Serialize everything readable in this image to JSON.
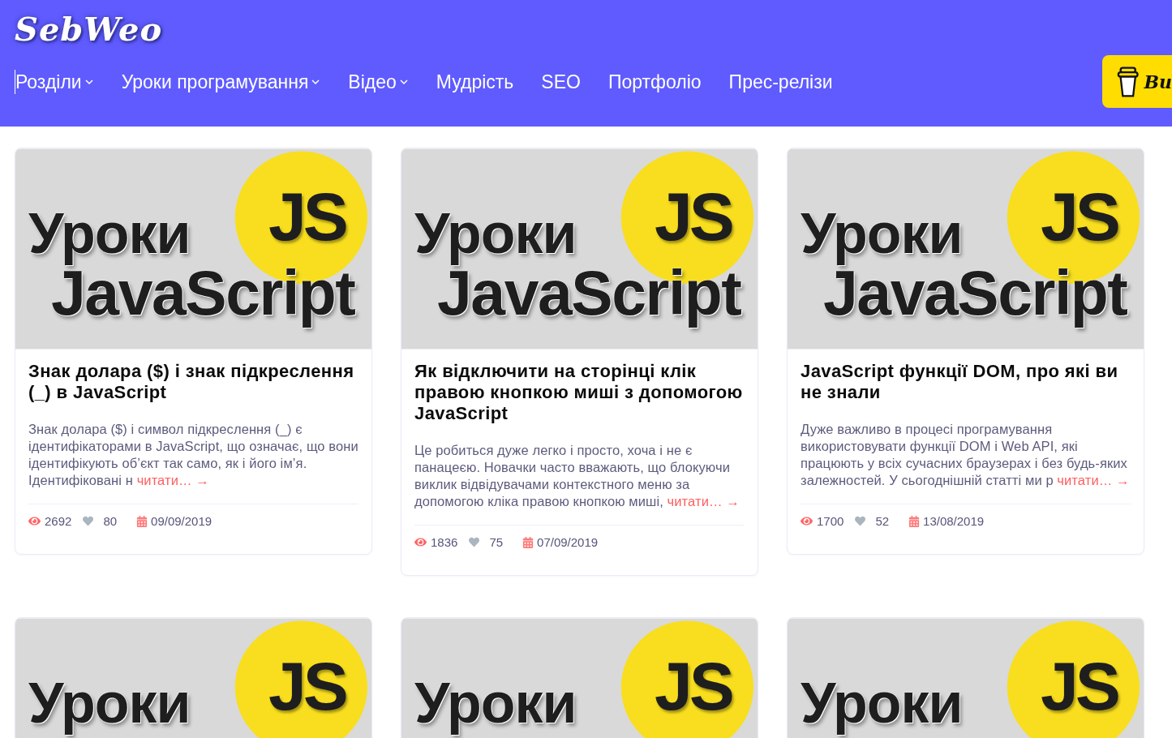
{
  "header": {
    "logo": "SebWeo",
    "nav": [
      {
        "label": "Розділи",
        "dropdown": true,
        "focused": true
      },
      {
        "label": "Уроки програмування",
        "dropdown": true,
        "focused": false
      },
      {
        "label": "Відео",
        "dropdown": true,
        "focused": false
      },
      {
        "label": "Мудрість",
        "dropdown": false,
        "focused": false
      },
      {
        "label": "SEO",
        "dropdown": false,
        "focused": false
      },
      {
        "label": "Портфоліо",
        "dropdown": false,
        "focused": false
      },
      {
        "label": "Прес-релізи",
        "dropdown": false,
        "focused": false
      }
    ],
    "cta": {
      "label": "Bu"
    }
  },
  "cards": [
    {
      "thumbnail": {
        "line_1": "Уроки",
        "line_2": "JavaScript",
        "badge": "JS"
      },
      "title": "Знак долара ($) і знак підкреслення (_) в JavaScript",
      "excerpt": "Знак долара ($) і символ підкреслення (_) є ідентифікаторами в JavaScript, що означає, що вони ідентифікують об’єкт так само, як і його ім’я. Ідентифіковані н",
      "read_more": "читати… →",
      "views": "2692",
      "likes": "80",
      "date": "09/09/2019"
    },
    {
      "thumbnail": {
        "line_1": "Уроки",
        "line_2": "JavaScript",
        "badge": "JS"
      },
      "title": "Як відключити на сторінці клік правою кнопкою миші з допомогою JavaScript",
      "excerpt": "Це робиться дуже легко і просто, хоча і не є панацеєю. Новачки часто вважають, що блокуючи виклик відвідувачами контекстного меню за допомогою кліка правою кнопкою миші,",
      "read_more": "читати… →",
      "views": "1836",
      "likes": "75",
      "date": "07/09/2019"
    },
    {
      "thumbnail": {
        "line_1": "Уроки",
        "line_2": "JavaScript",
        "badge": "JS"
      },
      "title": "JavaScript функції DOM, про які ви не знали",
      "excerpt": "Дуже важливо в процесі програмування використовувати функції DOM і Web API, які працюють у всіх сучасних браузерах і без будь-яких залежностей. У сьогоднішній статті ми р",
      "read_more": "читати… →",
      "views": "1700",
      "likes": "52",
      "date": "13/08/2019"
    },
    {
      "thumbnail": {
        "line_1": "Уроки",
        "badge": "JS"
      }
    },
    {
      "thumbnail": {
        "line_1": "Уроки",
        "badge": "JS"
      }
    },
    {
      "thumbnail": {
        "line_1": "Уроки",
        "badge": "JS"
      }
    }
  ]
}
